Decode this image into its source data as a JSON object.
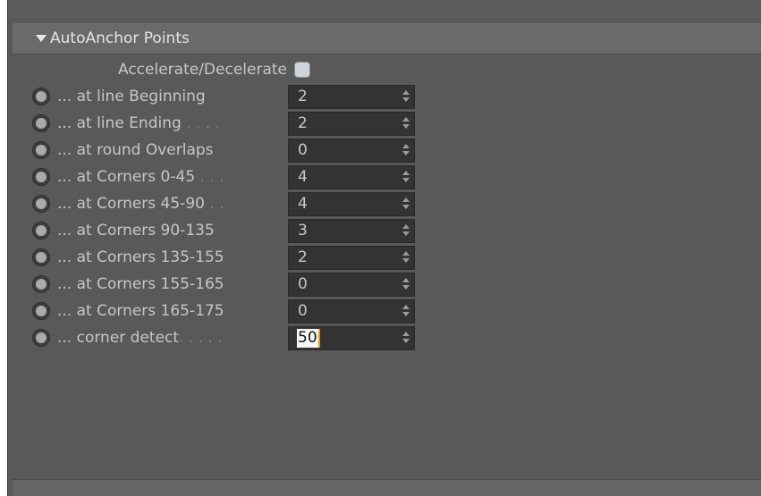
{
  "section": {
    "title": "AutoAnchor Points"
  },
  "accelerate": {
    "label": "Accelerate/Decelerate",
    "checked": false
  },
  "rows": [
    {
      "label": "... at line Beginning",
      "dots": "",
      "value": "2"
    },
    {
      "label": "... at line Ending",
      "dots": " . . . .",
      "value": "2"
    },
    {
      "label": "... at round Overlaps",
      "dots": "",
      "value": "0"
    },
    {
      "label": "... at Corners 0-45",
      "dots": " . . .",
      "value": "4"
    },
    {
      "label": "... at Corners 45-90",
      "dots": " . .",
      "value": "4"
    },
    {
      "label": "... at Corners 90-135",
      "dots": "",
      "value": "3"
    },
    {
      "label": "... at Corners 135-155",
      "dots": "",
      "value": "2"
    },
    {
      "label": "... at Corners 155-165",
      "dots": "",
      "value": "0"
    },
    {
      "label": "... at Corners 165-175",
      "dots": "",
      "value": "0"
    },
    {
      "label": "... corner detect",
      "dots": ". . . . .",
      "value": "50"
    }
  ]
}
